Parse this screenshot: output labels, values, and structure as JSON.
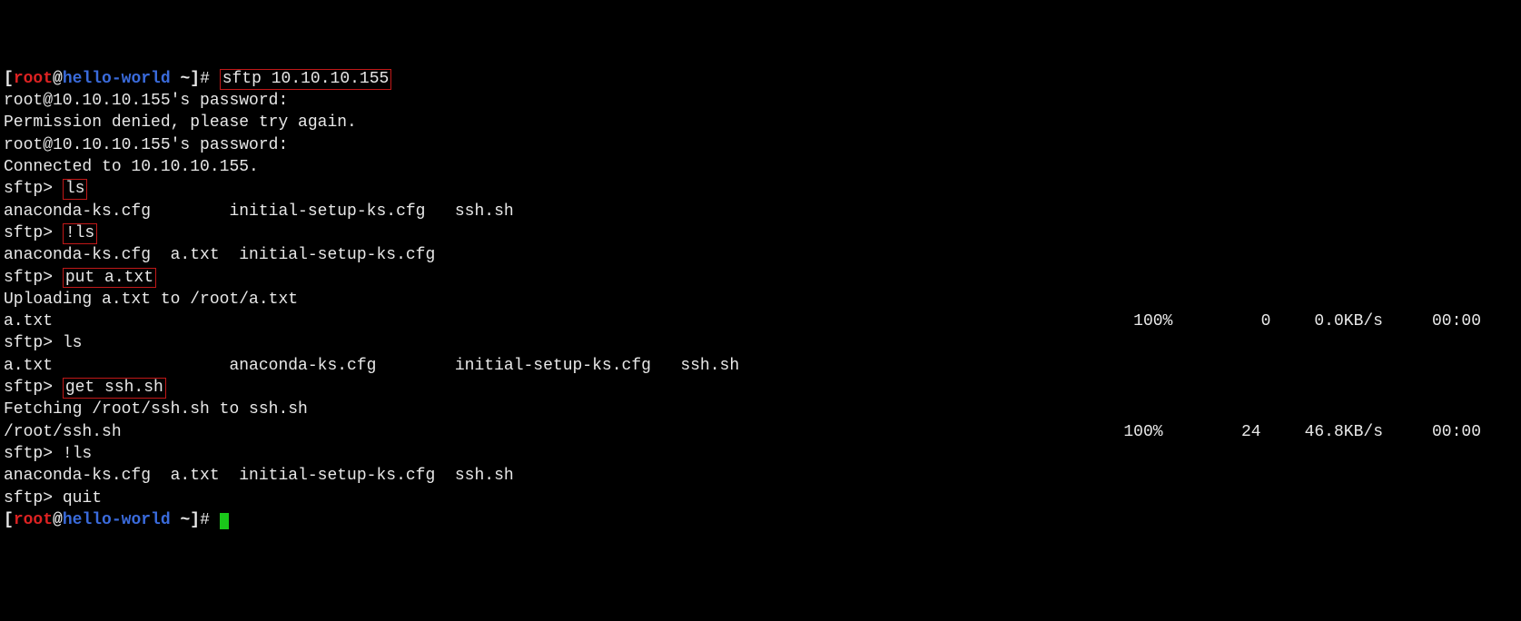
{
  "prompt": {
    "open_bracket": "[",
    "user": "root",
    "at": "@",
    "host": "hello-world",
    "path": " ~",
    "close_bracket": "]",
    "hash": "# "
  },
  "cmd_sftp": "sftp 10.10.10.155",
  "pw_prompt1": "root@10.10.10.155's password:",
  "perm_denied": "Permission denied, please try again.",
  "pw_prompt2": "root@10.10.10.155's password:",
  "connected": "Connected to 10.10.10.155.",
  "sftp_prefix": "sftp> ",
  "cmd_ls1": "ls",
  "ls1_out": "anaconda-ks.cfg        initial-setup-ks.cfg   ssh.sh",
  "cmd_bangls1": "!ls",
  "bangls1_out": "anaconda-ks.cfg  a.txt  initial-setup-ks.cfg",
  "cmd_put": "put a.txt",
  "put_msg": "Uploading a.txt to /root/a.txt",
  "put_file": "a.txt",
  "put_stats": {
    "pct": "100%",
    "bytes": "0",
    "rate": "0.0KB/s",
    "time": "00:00"
  },
  "cmd_ls2": "ls",
  "ls2_out": "a.txt                  anaconda-ks.cfg        initial-setup-ks.cfg   ssh.sh",
  "cmd_get": "get ssh.sh",
  "get_msg": "Fetching /root/ssh.sh to ssh.sh",
  "get_file": "/root/ssh.sh",
  "get_stats": {
    "pct": "100%",
    "bytes": "24",
    "rate": "46.8KB/s",
    "time": "00:00"
  },
  "cmd_bangls2": "!ls",
  "bangls2_out": "anaconda-ks.cfg  a.txt  initial-setup-ks.cfg  ssh.sh",
  "cmd_quit": "quit"
}
